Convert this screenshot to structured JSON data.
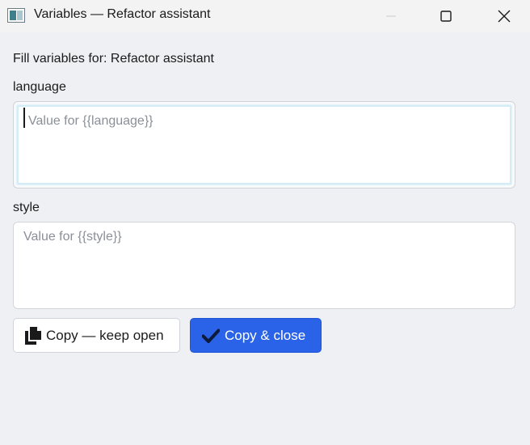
{
  "window": {
    "title": "Variables — Refactor assistant",
    "app_icon": "window-app-icon",
    "controls": [
      "minimize",
      "maximize",
      "close"
    ]
  },
  "form": {
    "heading": "Fill variables for: Refactor assistant",
    "fields": [
      {
        "label": "language",
        "value": "",
        "placeholder": "Value for {{language}}",
        "focused": true
      },
      {
        "label": "style",
        "value": "",
        "placeholder": "Value for {{style}}",
        "focused": false
      }
    ]
  },
  "actions": {
    "copy_keep_open": {
      "label": "Copy — keep open",
      "icon": "copy-icon"
    },
    "copy_close": {
      "label": "Copy & close",
      "icon": "checkmark-icon"
    }
  },
  "colors": {
    "background": "#eff0f4",
    "primary": "#2a63e8",
    "focus_ring": "#d3ecf6"
  }
}
